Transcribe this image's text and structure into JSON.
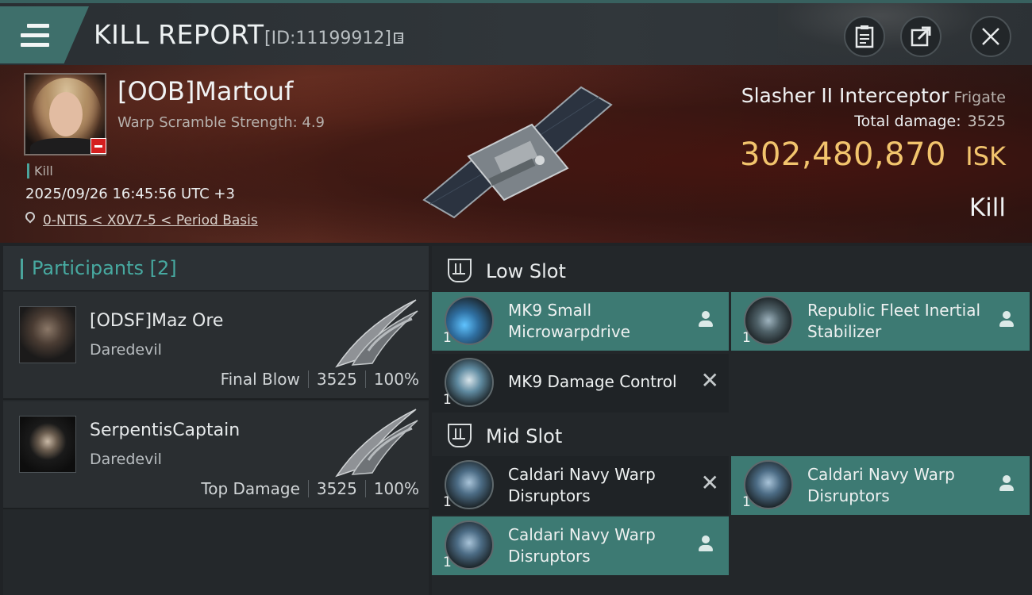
{
  "window": {
    "title": "KILL REPORT",
    "report_id": "[ID:11199912]",
    "icons": [
      "menu-icon",
      "copy-icon",
      "clipboard-icon",
      "share-icon",
      "close-icon"
    ]
  },
  "victim": {
    "name": "[OOB]Martouf",
    "warp_scramble": "Warp Scramble Strength: 4.9",
    "tag": "Kill",
    "datetime": "2025/09/26 16:45:56 UTC +3",
    "location": "0-NTIS < X0V7-5 < Period Basis"
  },
  "ship": {
    "name": "Slasher II Interceptor",
    "class": "Frigate",
    "damage_label": "Total damage:",
    "damage_value": "3525",
    "isk_value": "302,480,870",
    "isk_unit": "ISK",
    "result": "Kill"
  },
  "participants": {
    "title": "Participants",
    "count": "[2]",
    "rows": [
      {
        "name": "[ODSF]Maz Ore",
        "ship": "Daredevil",
        "role": "Final Blow",
        "damage": "3525",
        "percent": "100%"
      },
      {
        "name": "SerpentisCaptain",
        "ship": "Daredevil",
        "role": "Top Damage",
        "damage": "3525",
        "percent": "100%"
      }
    ]
  },
  "fitting": {
    "low_slot": {
      "title": "Low Slot",
      "modules": [
        {
          "name": "MK9 Small Microwarpdrive",
          "qty": "1",
          "state": "person"
        },
        {
          "name": "Republic Fleet Inertial Stabilizer",
          "qty": "1",
          "state": "person"
        },
        {
          "name": "MK9 Damage Control",
          "qty": "1",
          "state": "destroyed"
        }
      ]
    },
    "mid_slot": {
      "title": "Mid Slot",
      "modules": [
        {
          "name": "Caldari Navy Warp Disruptors",
          "qty": "1",
          "state": "destroyed"
        },
        {
          "name": "Caldari Navy Warp Disruptors",
          "qty": "1",
          "state": "person"
        },
        {
          "name": "Caldari Navy Warp Disruptors",
          "qty": "1",
          "state": "person"
        }
      ]
    }
  }
}
